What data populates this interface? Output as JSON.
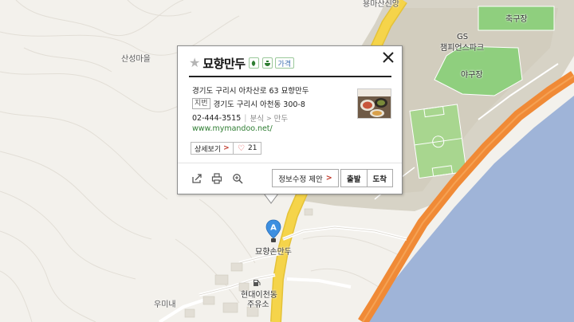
{
  "popup": {
    "title": "묘향만두",
    "badge_text": "가격",
    "road_address": "경기도 구리시 아차산로 63 묘향만두",
    "jibun_label": "지번",
    "jibun_address": "경기도 구리시 아천동 300-8",
    "phone": "02-444-3515",
    "category_parent": "분식",
    "category": "만두",
    "url": "www.mymandoo.net/",
    "detail_label": "상세보기",
    "like_count": "21",
    "suggest_label": "정보수정 제안",
    "depart_label": "출발",
    "arrive_label": "도착"
  },
  "marker": {
    "letter": "A",
    "label": "묘향손만두"
  },
  "map_labels": {
    "sinsan": "산성마을",
    "top": "용마산신앙",
    "soccer": "축구장",
    "gs1": "GS",
    "gs2": "챔피언스파크",
    "baseball": "야구장",
    "gas1": "현대이천동",
    "gas2": "주유소",
    "umine": "우미내"
  },
  "colors": {
    "land": "#f3f1ec",
    "park_area": "#d7d3c6",
    "green_field": "#8fcf7e",
    "road_yellow": "#f5d44a",
    "highway_orange": "#f08a36",
    "river": "#9fb4d8",
    "marker_blue": "#3d8fe0"
  }
}
